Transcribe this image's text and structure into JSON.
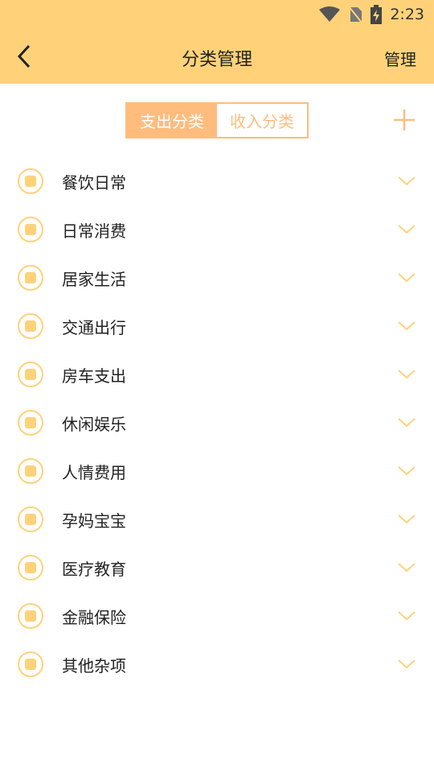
{
  "status": {
    "time": "2:23",
    "icons": [
      "wifi-icon",
      "no-sim-icon",
      "battery-charging-icon"
    ]
  },
  "toolbar": {
    "title": "分类管理",
    "manage_label": "管理"
  },
  "segment": {
    "expense_label": "支出分类",
    "income_label": "收入分类",
    "active": "expense"
  },
  "categories": [
    {
      "label": "餐饮日常",
      "icon": "bowl-icon"
    },
    {
      "label": "日常消费",
      "icon": "receipt-icon"
    },
    {
      "label": "居家生活",
      "icon": "house-icon"
    },
    {
      "label": "交通出行",
      "icon": "person-walking-icon"
    },
    {
      "label": "房车支出",
      "icon": "home-car-icon"
    },
    {
      "label": "休闲娱乐",
      "icon": "coffee-cup-icon"
    },
    {
      "label": "人情费用",
      "icon": "gift-box-icon"
    },
    {
      "label": "孕妈宝宝",
      "icon": "baby-bottle-icon"
    },
    {
      "label": "医疗教育",
      "icon": "graduation-cap-icon"
    },
    {
      "label": "金融保险",
      "icon": "money-bag-icon"
    },
    {
      "label": "其他杂项",
      "icon": "grid-apps-icon"
    }
  ],
  "colors": {
    "primary": "#ffd27a",
    "accent": "#ffbc7d"
  }
}
